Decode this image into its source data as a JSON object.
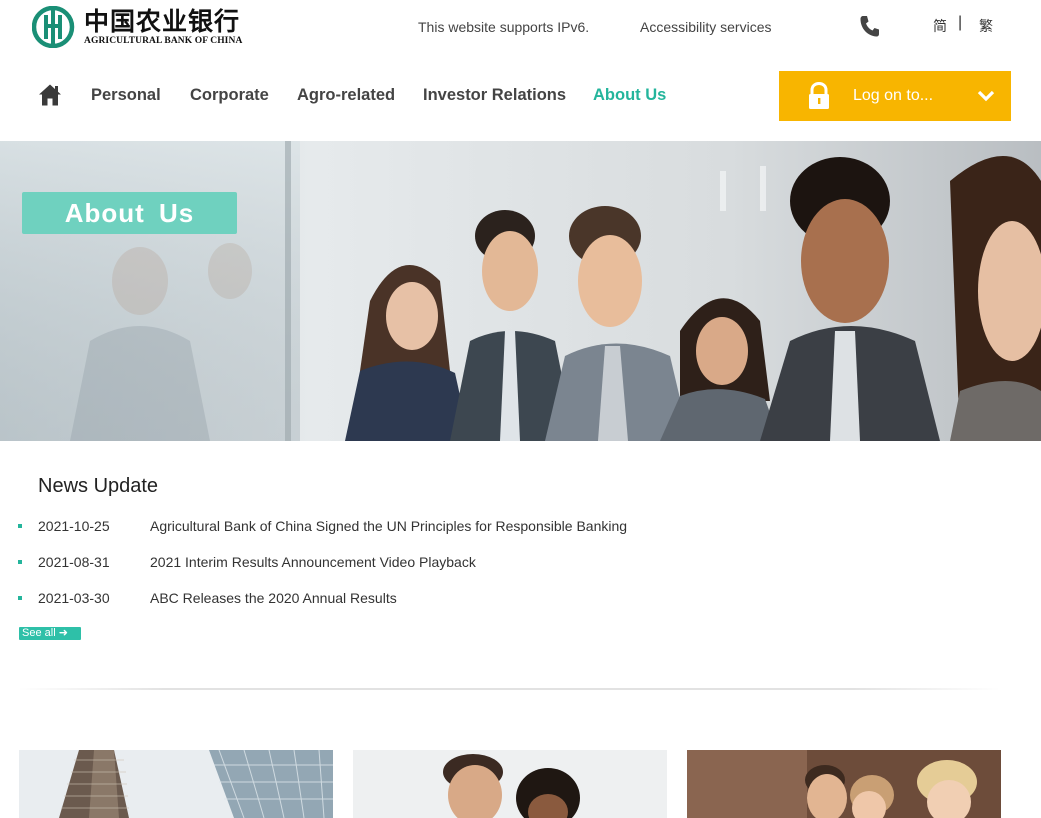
{
  "header": {
    "logo": {
      "cn_name": "中国农业银行",
      "en_name": "AGRICULTURAL BANK OF CHINA"
    },
    "ipv6_text": "This website supports IPv6.",
    "accessibility_label": "Accessibility services",
    "phone_icon": "phone-icon",
    "lang_simplified": "简",
    "lang_separator": "|",
    "lang_traditional": "繁"
  },
  "nav": {
    "home_icon": "home-icon",
    "items": [
      {
        "label": "Personal",
        "active": false
      },
      {
        "label": "Corporate",
        "active": false
      },
      {
        "label": "Agro-related",
        "active": false
      },
      {
        "label": "Investor Relations",
        "active": false
      },
      {
        "label": "About Us",
        "active": true
      }
    ],
    "login": {
      "label": "Log on to...",
      "icon": "lock-icon",
      "chevron": "chevron-down-icon"
    }
  },
  "banner": {
    "title": "About  Us"
  },
  "news": {
    "heading": "News Update",
    "items": [
      {
        "date": "2021-10-25",
        "title": "Agricultural Bank of China Signed the UN Principles for Responsible Banking"
      },
      {
        "date": "2021-08-31",
        "title": "2021 Interim Results Announcement Video Playback"
      },
      {
        "date": "2021-03-30",
        "title": "ABC Releases the 2020 Annual Results"
      }
    ],
    "see_all": "See all ➜"
  },
  "colors": {
    "accent_teal": "#24b59c",
    "login_orange": "#f8b500",
    "banner_title_bg": "#6fd1bf"
  }
}
